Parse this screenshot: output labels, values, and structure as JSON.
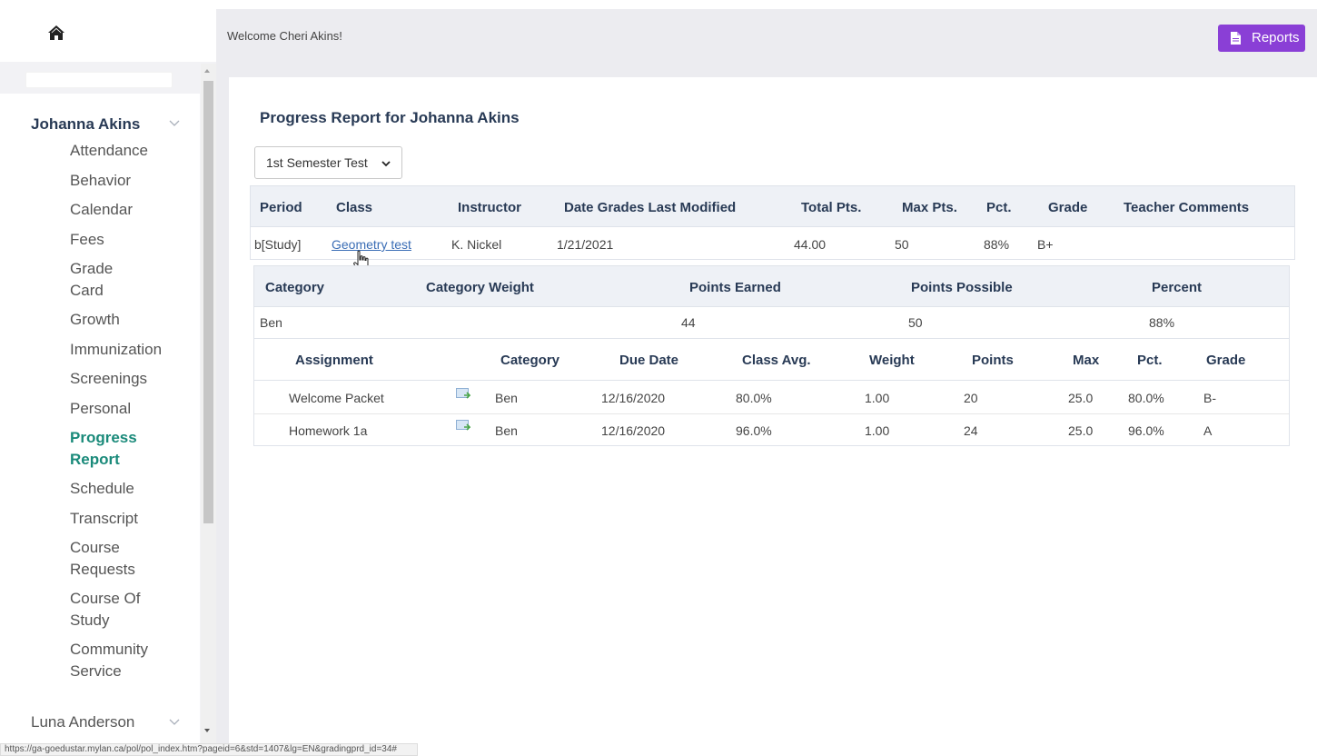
{
  "header": {
    "welcome": "Welcome Cheri Akins!",
    "reports_label": "Reports"
  },
  "sidebar": {
    "student_name": "Johanna Akins",
    "items": [
      {
        "label": "Attendance"
      },
      {
        "label": "Behavior"
      },
      {
        "label": "Calendar"
      },
      {
        "label": "Fees"
      },
      {
        "label": "Grade Card"
      },
      {
        "label": "Growth"
      },
      {
        "label": "Immunization"
      },
      {
        "label": "Screenings"
      },
      {
        "label": "Personal"
      },
      {
        "label": "Progress Report",
        "active": true
      },
      {
        "label": "Schedule"
      },
      {
        "label": "Transcript"
      },
      {
        "label": "Course Requests"
      },
      {
        "label": "Course Of Study"
      },
      {
        "label": "Community Service"
      }
    ],
    "other_student": "Luna Anderson"
  },
  "main": {
    "title": "Progress Report for Johanna Akins",
    "term_select": "1st Semester Test",
    "class_table": {
      "headers": [
        "Period",
        "Class",
        "Instructor",
        "Date Grades Last Modified",
        "Total Pts.",
        "Max Pts.",
        "Pct.",
        "Grade",
        "Teacher Comments"
      ],
      "row": {
        "period": "b[Study]",
        "class": "Geometry test",
        "instructor": "K. Nickel",
        "modified": "1/21/2021",
        "total": "44.00",
        "max": "50",
        "pct": "88%",
        "grade": "B+",
        "comments": ""
      }
    },
    "category_table": {
      "headers": [
        "Category",
        "Category Weight",
        "Points Earned",
        "Points Possible",
        "Percent"
      ],
      "row": {
        "category": "Ben",
        "weight": "",
        "earned": "44",
        "possible": "50",
        "percent": "88%"
      }
    },
    "assignment_table": {
      "headers": [
        "Assignment",
        "Category",
        "Due Date",
        "Class Avg.",
        "Weight",
        "Points",
        "Max",
        "Pct.",
        "Grade"
      ],
      "rows": [
        {
          "assignment": "Welcome Packet",
          "category": "Ben",
          "due": "12/16/2020",
          "avg": "80.0%",
          "weight": "1.00",
          "points": "20",
          "max": "25.0",
          "pct": "80.0%",
          "grade": "B-"
        },
        {
          "assignment": "Homework 1a",
          "category": "Ben",
          "due": "12/16/2020",
          "avg": "96.0%",
          "weight": "1.00",
          "points": "24",
          "max": "25.0",
          "pct": "96.0%",
          "grade": "A"
        }
      ]
    }
  },
  "status_bar": {
    "url": "https://ga-goedustar.mylan.ca/pol/pol_index.htm?pageid=6&std=1407&lg=EN&gradingprd_id=34#"
  },
  "colors": {
    "accent_purple": "#8a3fd6",
    "active_teal": "#1a8a7a",
    "heading_navy": "#283a55",
    "link_blue": "#3a6db5"
  }
}
